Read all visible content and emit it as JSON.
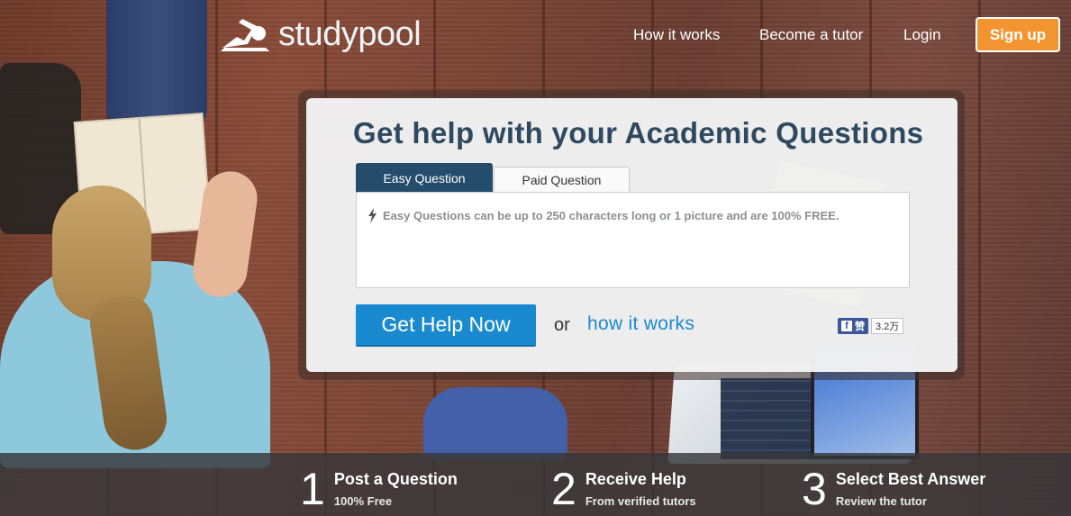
{
  "header": {
    "logo_text": "studypool",
    "nav": {
      "how_it_works": "How it works",
      "become_tutor": "Become a tutor",
      "login": "Login",
      "signup": "Sign up"
    }
  },
  "card": {
    "title": "Get help with your Academic Questions",
    "tabs": [
      {
        "label": "Easy Question",
        "active": true
      },
      {
        "label": "Paid Question",
        "active": false
      }
    ],
    "question_hint": "Easy Questions can be up to 250 characters long or 1 picture and are 100% FREE.",
    "get_help_button": "Get Help Now",
    "or_text": "or",
    "how_link": "how it works",
    "facebook": {
      "like_label": "赞",
      "count": "3.2万"
    }
  },
  "steps": [
    {
      "number": "1",
      "title": "Post a Question",
      "subtitle": "100% Free"
    },
    {
      "number": "2",
      "title": "Receive Help",
      "subtitle": "From verified tutors"
    },
    {
      "number": "3",
      "title": "Select Best Answer",
      "subtitle": "Review the tutor"
    }
  ],
  "colors": {
    "primary_button": "#1a8ad0",
    "signup_button": "#f29530",
    "active_tab": "#254c6a",
    "title_text": "#2f4a60"
  }
}
